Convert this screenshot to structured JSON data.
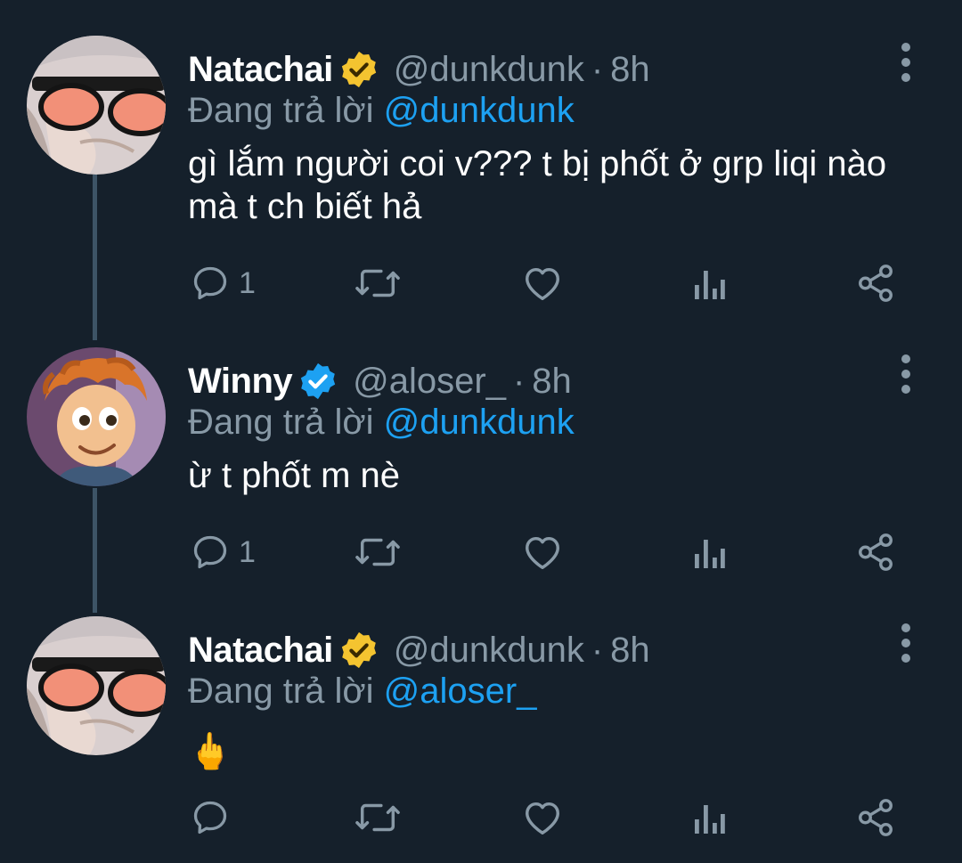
{
  "tweets": [
    {
      "author": {
        "name": "Natachai",
        "handle": "@dunkdunk",
        "verified_badge_color": "#f4c430",
        "avatar": "sunglasses-avatar"
      },
      "separator": "·",
      "time": "8h",
      "reply_prefix": "Đang trả lời",
      "reply_to": "@dunkdunk",
      "text": "gì lắm người coi v??? t bị phốt ở grp liqi nào mà t ch biết hả",
      "replies": "1"
    },
    {
      "author": {
        "name": "Winny",
        "handle": "@aloser_",
        "verified_badge_color": "#1da1f2",
        "avatar": "cartoon-avatar"
      },
      "separator": "·",
      "time": "8h",
      "reply_prefix": "Đang trả lời",
      "reply_to": "@dunkdunk",
      "text": "ừ t phốt m nè",
      "replies": "1"
    },
    {
      "author": {
        "name": "Natachai",
        "handle": "@dunkdunk",
        "verified_badge_color": "#f4c430",
        "avatar": "sunglasses-avatar"
      },
      "separator": "·",
      "time": "8h",
      "reply_prefix": "Đang trả lời",
      "reply_to": "@aloser_",
      "text": "🖕",
      "replies": ""
    }
  ],
  "colors": {
    "background": "#15202b",
    "muted": "#8899a6",
    "link": "#1da1f2",
    "thread_line": "#3d5466"
  },
  "icons": [
    "reply-icon",
    "retweet-icon",
    "like-icon",
    "analytics-icon",
    "share-icon",
    "more-icon",
    "verified-icon"
  ]
}
